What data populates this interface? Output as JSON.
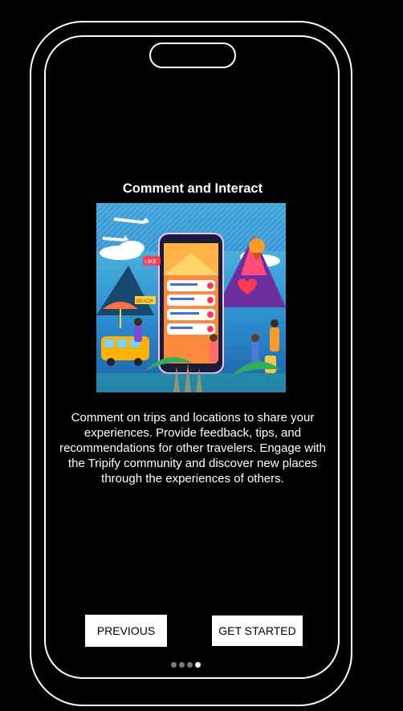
{
  "screen": {
    "title": "Comment and Interact",
    "description": "Comment on trips and locations to share your experiences. Provide feedback, tips, and recommendations for other travelers. Engage with the Tripify community and discover new places through the experiences of others."
  },
  "illustration": {
    "badge_text": "LIKE",
    "sign_text": "BEACH"
  },
  "buttons": {
    "previous_label": "PREVIOUS",
    "get_started_label": "GET STARTED"
  },
  "pager": {
    "total": 4,
    "current": 4
  },
  "colors": {
    "background": "#000000",
    "frame": "#ffffff",
    "button_bg": "#ffffff",
    "button_text": "#000000",
    "dot_inactive": "#7a7a7a",
    "dot_active": "#ffffff"
  }
}
